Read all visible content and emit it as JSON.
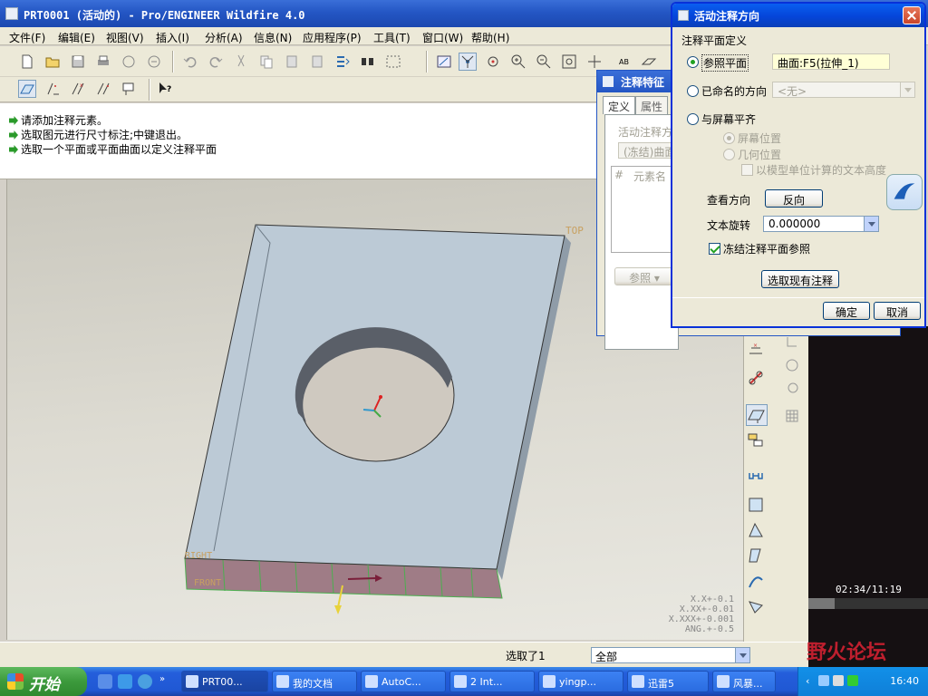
{
  "app": {
    "title": "PRT0001 (活动的) - Pro/ENGINEER Wildfire 4.0"
  },
  "menu": [
    "文件(F)",
    "编辑(E)",
    "视图(V)",
    "插入(I)",
    "分析(A)",
    "信息(N)",
    "应用程序(P)",
    "工具(T)",
    "窗口(W)",
    "帮助(H)"
  ],
  "messages": [
    "请添加注释元素。",
    "选取图元进行尺寸标注;中键退出。",
    "选取一个平面或平面曲面以定义注释平面"
  ],
  "model": {
    "datum_top": "TOP",
    "datum_right": "RIGHT",
    "datum_front": "FRONT"
  },
  "tolerances": [
    "X.X+-0.1",
    "X.XX+-0.01",
    "X.XXX+-0.001",
    "ANG.+-0.5"
  ],
  "status": {
    "selected_text": "选取了1",
    "filter_value": "全部"
  },
  "feature_dialog": {
    "title": "注释特征",
    "tabs": [
      "定义",
      "属性"
    ],
    "active_plane_label": "活动注释方",
    "frozen_value": "(冻结)曲面",
    "col_hash": "#",
    "col_element": "元素名",
    "ref_button": "参照"
  },
  "orient_dialog": {
    "title": "活动注释方向",
    "section_label": "注释平面定义",
    "opt_ref_plane": "参照平面",
    "ref_plane_value": "曲面:F5(拉伸_1)",
    "opt_named_dir": "已命名的方向",
    "named_dir_value": "<无>",
    "opt_screen_align": "与屏幕平齐",
    "sub_screen_pos": "屏幕位置",
    "sub_geom_pos": "几何位置",
    "chk_model_units": "以模型单位计算的文本高度",
    "view_dir_label": "查看方向",
    "reverse_button": "反向",
    "rotate_label": "文本旋转",
    "rotate_value": "0.000000",
    "chk_freeze": "冻结注释平面参照",
    "select_existing_button": "选取现有注释",
    "ok_button": "确定",
    "cancel_button": "取消"
  },
  "video": {
    "time": "02:34/11:19",
    "progress": 0.22
  },
  "taskbar": {
    "start_label": "开始",
    "tasks": [
      "PRT00...",
      "我的文档",
      "AutoC...",
      "2 Int...",
      "yingp...",
      "迅雷5",
      "风暴..."
    ],
    "clock": "16:40",
    "watermark": "野火论坛"
  },
  "colors": {
    "xp_blue": "#0545d9",
    "model_face": "#bccad6",
    "viewport_bg": "#dddbd2"
  }
}
